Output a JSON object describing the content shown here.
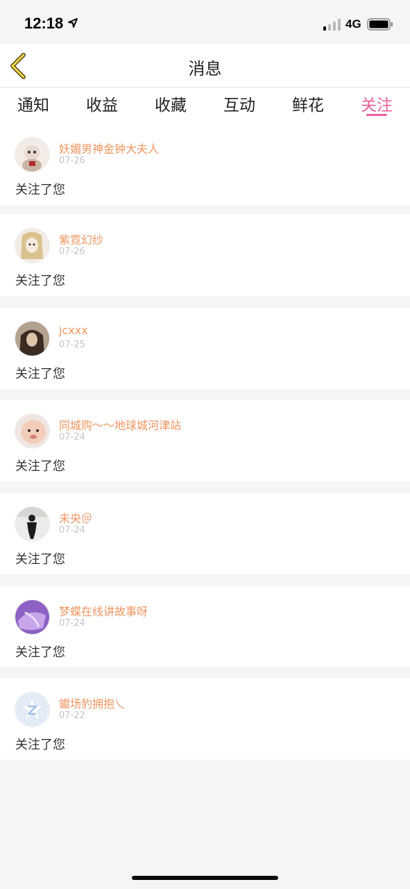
{
  "status": {
    "time": "12:18",
    "network": "4G"
  },
  "nav": {
    "title": "消息"
  },
  "tabs": [
    {
      "label": "通知"
    },
    {
      "label": "收益"
    },
    {
      "label": "收藏"
    },
    {
      "label": "互动"
    },
    {
      "label": "鲜花"
    },
    {
      "label": "关注",
      "active": true
    }
  ],
  "messages": [
    {
      "name": "妖媚男神金钟大夫人",
      "date": "07-26",
      "text": "关注了您"
    },
    {
      "name": "紫霓幻纱",
      "date": "07-26",
      "text": "关注了您"
    },
    {
      "name": "jcxxx",
      "date": "07-25",
      "text": "关注了您"
    },
    {
      "name": "同城购～～地球城河津站",
      "date": "07-24",
      "text": "关注了您"
    },
    {
      "name": "未央＠",
      "date": "07-24",
      "text": "关注了您"
    },
    {
      "name": "梦蝶在线讲故事呀",
      "date": "07-24",
      "text": "关注了您"
    },
    {
      "name": "钀场豹拥抱乀",
      "date": "07-22",
      "text": "关注了您"
    }
  ],
  "colors": {
    "accent": "#e9609b",
    "username": "#ef9661",
    "date": "#c4c4c4"
  }
}
